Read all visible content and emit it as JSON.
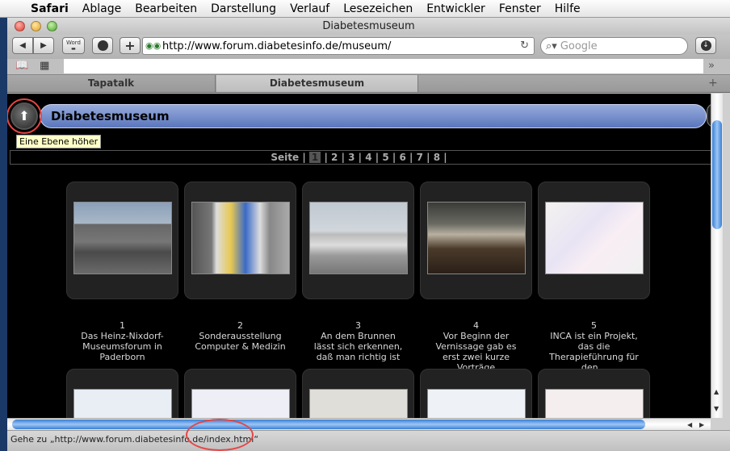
{
  "menubar": {
    "apple": "",
    "items": [
      "Safari",
      "Ablage",
      "Bearbeiten",
      "Darstellung",
      "Verlauf",
      "Lesezeichen",
      "Entwickler",
      "Fenster",
      "Hilfe"
    ]
  },
  "window": {
    "title": "Diabetesmuseum"
  },
  "toolbar": {
    "back": "◀",
    "forward": "▶",
    "word_label": "Word",
    "add": "+",
    "url": "http://www.forum.diabetesinfo.de/museum/",
    "search_placeholder": "Google"
  },
  "tabs": [
    {
      "label": "Tapatalk",
      "active": false
    },
    {
      "label": "Diabetesmuseum",
      "active": true
    }
  ],
  "page": {
    "title": "Diabetesmuseum",
    "tooltip": "Eine Ebene höher",
    "pager": {
      "label": "Seite",
      "current": "1",
      "pages": [
        "2",
        "3",
        "4",
        "5",
        "6",
        "7",
        "8"
      ]
    }
  },
  "items": [
    {
      "num": "1",
      "caption": "Das Heinz-Nixdorf-Museumsforum in Paderborn"
    },
    {
      "num": "2",
      "caption": "Sonderausstellung Computer & Medizin"
    },
    {
      "num": "3",
      "caption": "An dem Brunnen lässt sich erkennen, daß man richtig ist"
    },
    {
      "num": "4",
      "caption": "Vor Beginn der Vernissage gab es erst zwei kurze Vorträge"
    },
    {
      "num": "5",
      "caption": "INCA ist ein Projekt, das die Therapieführung für den..."
    }
  ],
  "status": {
    "text": "Gehe zu „http://www.forum.diabetesinfo.de/index.html“"
  },
  "colors": {
    "accent": "#5a76bc",
    "highlight": "#e84545"
  }
}
